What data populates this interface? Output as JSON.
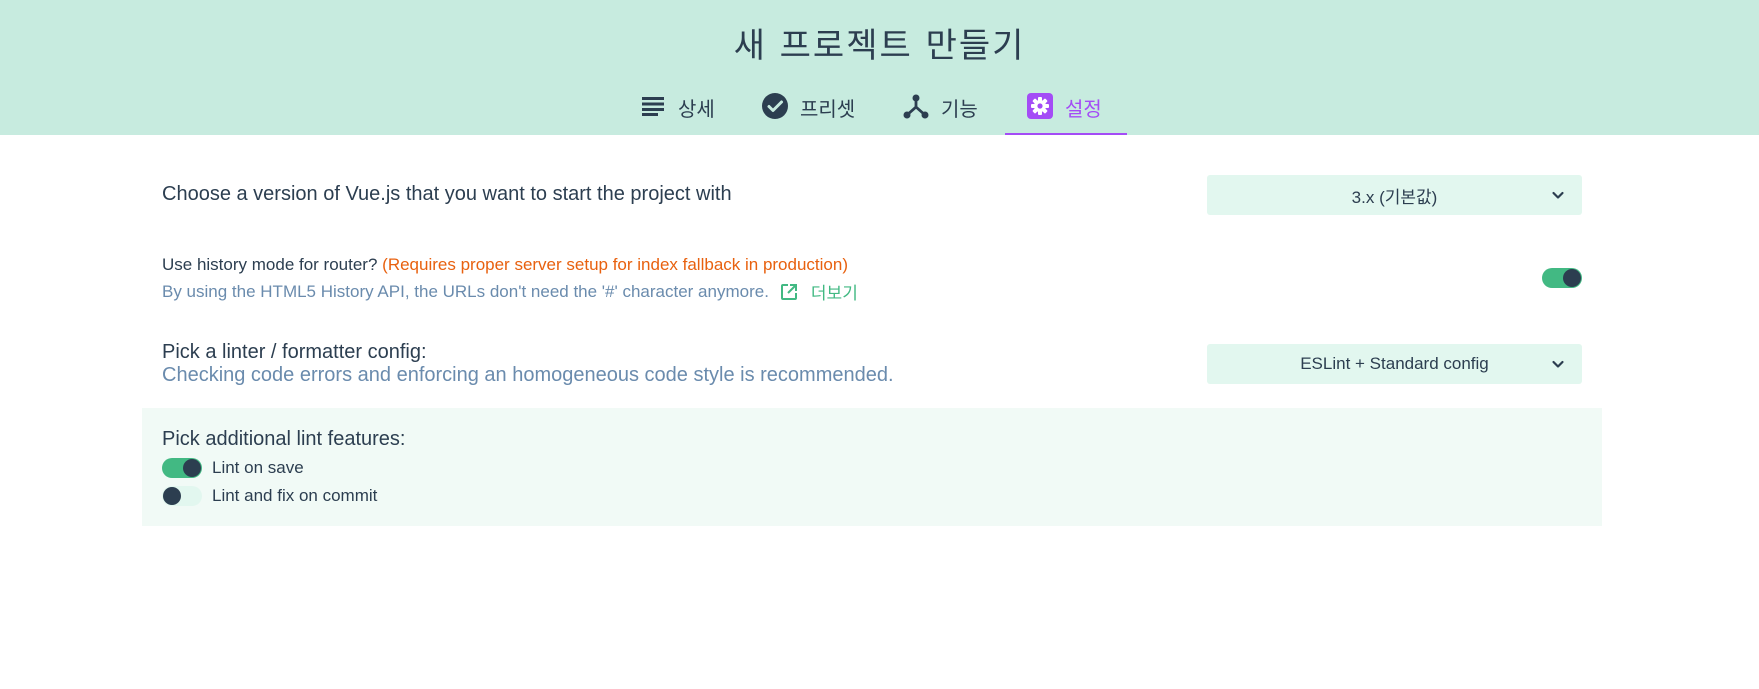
{
  "header": {
    "title": "새 프로젝트 만들기",
    "tabs": [
      {
        "label": "상세",
        "icon": "list-icon"
      },
      {
        "label": "프리셋",
        "icon": "check-circle-icon"
      },
      {
        "label": "기능",
        "icon": "fork-icon"
      },
      {
        "label": "설정",
        "icon": "gear-icon",
        "active": true
      }
    ]
  },
  "settings": {
    "vue_version": {
      "label": "Choose a version of Vue.js that you want to start the project with",
      "value": "3.x (기본값)"
    },
    "history_mode": {
      "label": "Use history mode for router?",
      "warning": "(Requires proper server setup for index fallback in production)",
      "description": "By using the HTML5 History API, the URLs don't need the '#' character anymore.",
      "more_link": "더보기",
      "enabled": true
    },
    "linter": {
      "label": "Pick a linter / formatter config:",
      "description": "Checking code errors and enforcing an homogeneous code style is recommended.",
      "value": "ESLint + Standard config"
    },
    "lint_features": {
      "label": "Pick additional lint features:",
      "options": [
        {
          "label": "Lint on save",
          "enabled": true
        },
        {
          "label": "Lint and fix on commit",
          "enabled": false
        }
      ]
    }
  },
  "colors": {
    "header_bg": "#c7ebdf",
    "accent": "#42b983",
    "active_tab": "#a44cf6",
    "warning": "#e8610f",
    "description": "#6a8bad",
    "select_bg": "#e2f7ef"
  }
}
